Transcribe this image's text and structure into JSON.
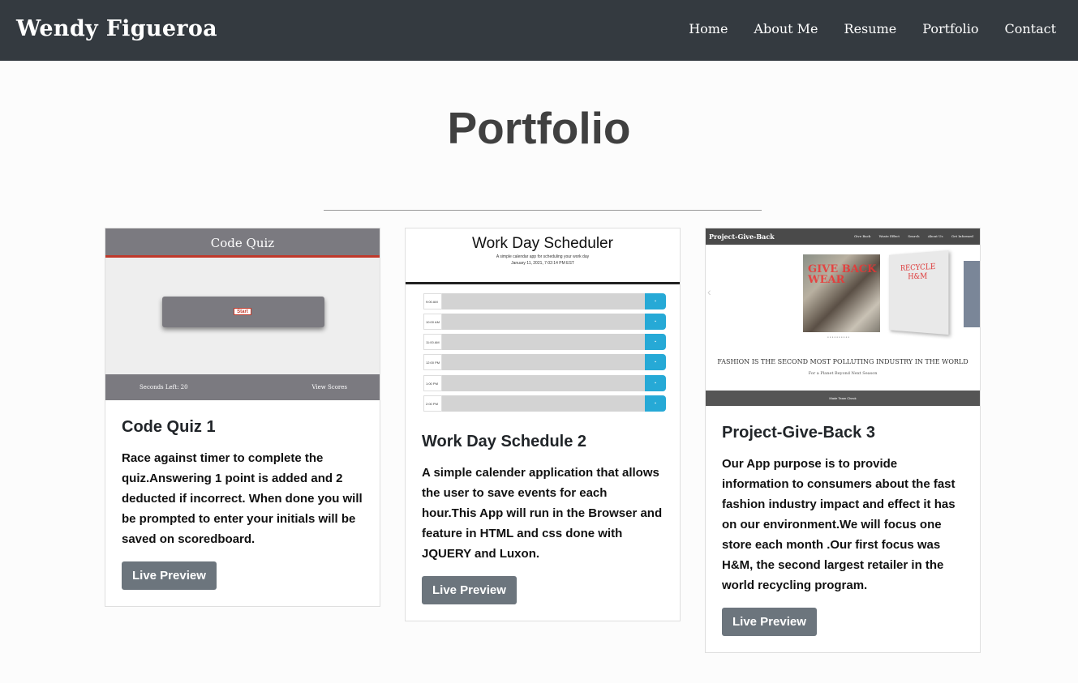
{
  "navbar": {
    "brand": "Wendy Figueroa",
    "links": [
      "Home",
      "About Me",
      "Resume",
      "Portfolio",
      "Contact"
    ]
  },
  "page": {
    "title": "Portfolio"
  },
  "cards": [
    {
      "title": "Code Quiz 1",
      "text": "Race against timer to complete the quiz.Answering 1 point is added and 2 deducted if incorrect. When done you will be prompted to enter your initials will be saved on scoredboard.",
      "button": "Live Preview",
      "preview": {
        "header": "Code Quiz",
        "start": "Start",
        "seconds": "Seconds Left: 20",
        "scores": "View Scores"
      }
    },
    {
      "title": "Work Day Schedule 2",
      "text": "A simple calender application that allows the user to save events for each hour.This App will run in the Browser and feature in HTML and css done with JQUERY and Luxon.",
      "button": "Live Preview",
      "preview": {
        "header": "Work Day Scheduler",
        "subheader": "A simple calendar app for scheduling your work day",
        "date": "January 11, 2021, 7:02:14 PM EST",
        "times": [
          "9:00 AM",
          "10:00 AM",
          "11:00 AM",
          "12:00 PM",
          "1:00 PM",
          "2:00 PM"
        ]
      }
    },
    {
      "title": "Project-Give-Back 3",
      "text": "Our App purpose is to provide information to consumers about the fast fashion industry impact and effect it has on our environment.We will focus one store each month .Our first focus was H&M, the second largest retailer in the world recycling program.",
      "button": "Live Preview",
      "preview": {
        "brand": "Project-Give-Back",
        "links": [
          "Give Back",
          "Waste Effect",
          "Search",
          "About Us",
          "Get Informed"
        ],
        "photo_text": "GIVE BACK WEAR",
        "poster_text": "RECYCLE H&M",
        "tagline": "FASHION IS THE SECOND MOST POLLUTING INDUSTRY IN THE WORLD",
        "subtagline": "For a Planet Beyond Next Season",
        "footer": "Made Team Check"
      }
    }
  ]
}
